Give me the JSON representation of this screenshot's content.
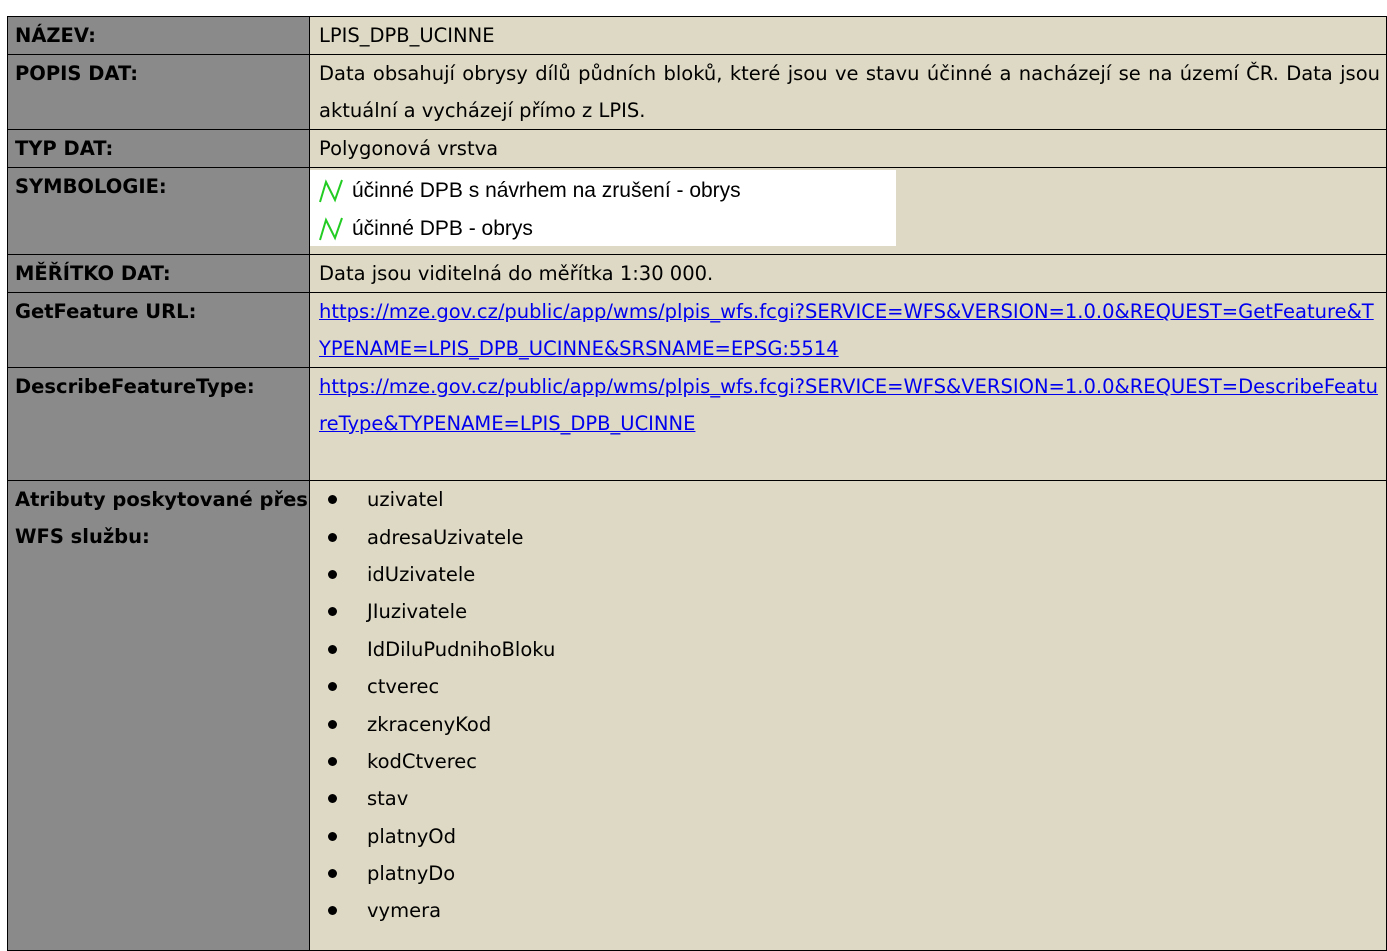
{
  "rows": {
    "nazev": {
      "label": "NÁZEV:",
      "value": "LPIS_DPB_UCINNE"
    },
    "popis": {
      "label": "POPIS DAT:",
      "value": "Data obsahují obrysy dílů půdních bloků, které jsou ve stavu účinné a nacházejí se na území ČR. Data jsou aktuální a vycházejí přímo z LPIS."
    },
    "typ": {
      "label": "TYP DAT:",
      "value": "Polygonová vrstva"
    },
    "symbologie": {
      "label": "SYMBOLOGIE:",
      "items": [
        {
          "icon": "green-outline-icon",
          "text": "účinné DPB s návrhem na zrušení - obrys"
        },
        {
          "icon": "green-outline-icon",
          "text": "účinné DPB - obrys"
        }
      ],
      "color": "#22cc22"
    },
    "meritko": {
      "label": "MĚŘÍTKO DAT:",
      "value": "Data jsou viditelná do měřítka 1:30 000."
    },
    "getfeature": {
      "label": "GetFeature URL:",
      "url": "https://mze.gov.cz/public/app/wms/plpis_wfs.fcgi?SERVICE=WFS&VERSION=1.0.0&REQUEST=GetFeature&TYPENAME=LPIS_DPB_UCINNE&SRSNAME=EPSG:5514"
    },
    "describe": {
      "label": "DescribeFeatureType:",
      "url": "https://mze.gov.cz/public/app/wms/plpis_wfs.fcgi?SERVICE=WFS&VERSION=1.0.0&REQUEST=DescribeFeatureType&TYPENAME=LPIS_DPB_UCINNE"
    },
    "atributy": {
      "label": "Atributy poskytované přes WFS službu:",
      "items": [
        "uzivatel",
        "adresaUzivatele",
        "idUzivatele",
        "JIuzivatele",
        "IdDiluPudnihoBloku",
        "ctverec",
        "zkracenyKod",
        "kodCtverec",
        "stav",
        "platnyOd",
        "platnyDo",
        "vymera"
      ]
    }
  }
}
